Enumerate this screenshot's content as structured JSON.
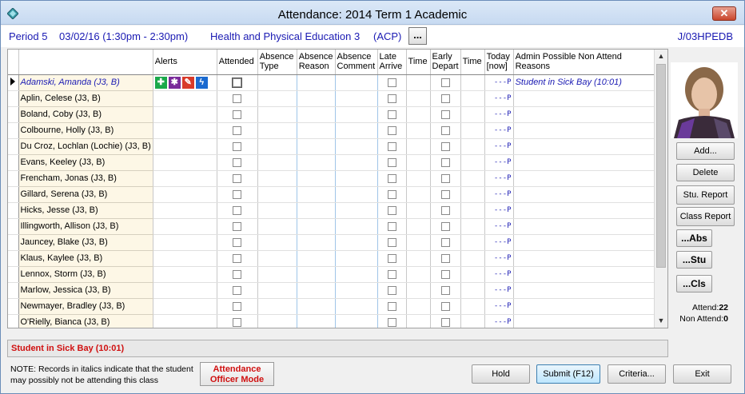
{
  "window": {
    "title": "Attendance:  2014 Term 1 Academic",
    "close_glyph": "✕"
  },
  "info": {
    "period": "Period 5",
    "datetime": "03/02/16 (1:30pm - 2:30pm)",
    "subject": "Health and Physical Education 3",
    "code": "(ACP)",
    "more_label": "...",
    "class_code": "J/03HPEDB"
  },
  "columns": {
    "alerts": "Alerts",
    "attended": "Attended",
    "absence_type": "Absence Type",
    "absence_reason": "Absence Reason",
    "absence_comment": "Absence Comment",
    "late_arrive": "Late Arrive",
    "time1": "Time",
    "early_depart": "Early Depart",
    "time2": "Time",
    "today_now": "Today [now]",
    "admin_reasons": "Admin Possible Non Attend Reasons"
  },
  "students": [
    {
      "name": "Adamski, Amanda (J3, B)",
      "today": "---P",
      "reason": "Student in Sick Bay (10:01)"
    },
    {
      "name": "Aplin, Celese (J3, B)",
      "today": "---P",
      "reason": ""
    },
    {
      "name": "Boland, Coby (J3, B)",
      "today": "---P",
      "reason": ""
    },
    {
      "name": "Colbourne, Holly (J3, B)",
      "today": "---P",
      "reason": ""
    },
    {
      "name": "Du Croz, Lochlan (Lochie) (J3, B)",
      "today": "---P",
      "reason": ""
    },
    {
      "name": "Evans, Keeley (J3, B)",
      "today": "---P",
      "reason": ""
    },
    {
      "name": "Frencham, Jonas (J3, B)",
      "today": "---P",
      "reason": ""
    },
    {
      "name": "Gillard, Serena (J3, B)",
      "today": "---P",
      "reason": ""
    },
    {
      "name": "Hicks, Jesse (J3, B)",
      "today": "---P",
      "reason": ""
    },
    {
      "name": "Illingworth, Allison (J3, B)",
      "today": "---P",
      "reason": ""
    },
    {
      "name": "Jauncey, Blake (J3, B)",
      "today": "---P",
      "reason": ""
    },
    {
      "name": "Klaus, Kaylee (J3, B)",
      "today": "---P",
      "reason": ""
    },
    {
      "name": "Lennox, Storm (J3, B)",
      "today": "---P",
      "reason": ""
    },
    {
      "name": "Marlow, Jessica (J3, B)",
      "today": "---P",
      "reason": ""
    },
    {
      "name": "Newmayer, Bradley (J3, B)",
      "today": "---P",
      "reason": ""
    },
    {
      "name": "O'Rielly, Bianca (J3, B)",
      "today": "---P",
      "reason": ""
    }
  ],
  "alert_icons": [
    {
      "name": "medical-cross-icon",
      "glyph": "✚",
      "color": "#1aa84a"
    },
    {
      "name": "puzzle-icon",
      "glyph": "✱",
      "color": "#7a2a9a"
    },
    {
      "name": "tools-icon",
      "glyph": "✎",
      "color": "#d83a2a"
    },
    {
      "name": "bolt-icon",
      "glyph": "ϟ",
      "color": "#1a6ad0"
    }
  ],
  "side_buttons": {
    "add": "Add...",
    "delete": "Delete",
    "stu_report": "Stu. Report",
    "class_report": "Class Report",
    "abs": "...Abs",
    "stu": "...Stu",
    "cls": "...Cls"
  },
  "counts": {
    "attend_label": "Attend:",
    "attend_value": "22",
    "non_attend_label": "Non Attend:",
    "non_attend_value": "0"
  },
  "status_text": "Student in Sick Bay (10:01)",
  "note": "NOTE:  Records in italics indicate that the student may possibly not be attending this class",
  "officer_button": "Attendance Officer Mode",
  "footer_buttons": {
    "hold": "Hold",
    "submit": "Submit (F12)",
    "criteria": "Criteria...",
    "exit": "Exit"
  },
  "colors": {
    "accent_blue": "#1a1ab3",
    "alert_red": "#d01010",
    "name_column_bg": "#fdf7e6"
  }
}
